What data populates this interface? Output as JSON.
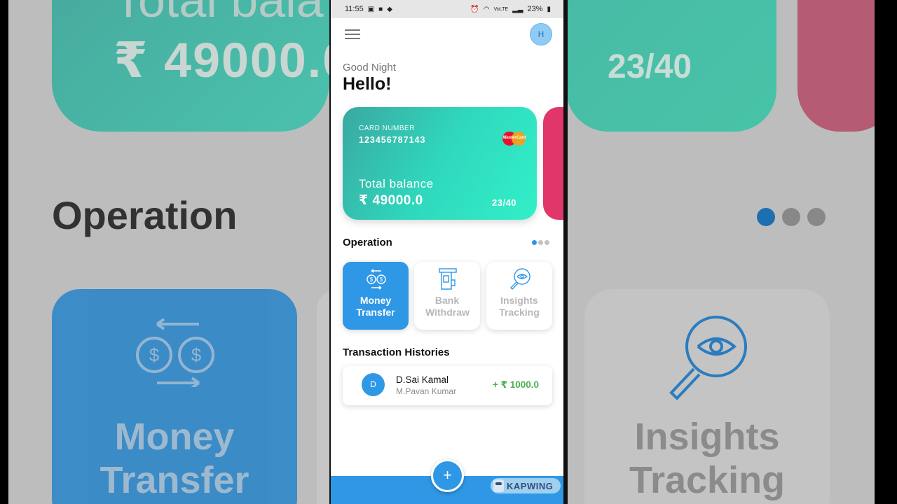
{
  "status_bar": {
    "time": "11:55",
    "network": "VoLTE",
    "battery": "23%"
  },
  "header": {
    "avatar_initial": "H"
  },
  "greeting": {
    "subtitle": "Good Night",
    "title": "Hello!"
  },
  "card": {
    "number_label": "CARD NUMBER",
    "number": "123456787143",
    "brand": "MasterCard",
    "balance_label": "Total balance",
    "balance": "₹ 49000.0",
    "ratio": "23/40"
  },
  "operation": {
    "title": "Operation",
    "page_count": 3,
    "active_page": 1,
    "tiles": [
      {
        "label": "Money Transfer",
        "icon": "money-transfer-icon",
        "active": true
      },
      {
        "label": "Bank Withdraw",
        "icon": "atm-icon",
        "active": false
      },
      {
        "label": "Insights Tracking",
        "icon": "insights-icon",
        "active": false
      }
    ]
  },
  "transactions": {
    "title": "Transaction Histories",
    "items": [
      {
        "initial": "D",
        "name": "D.Sai Kamal",
        "counterparty": "M.Pavan Kumar",
        "amount": "+ ₹ 1000.0"
      }
    ]
  },
  "fab": {
    "symbol": "+"
  },
  "watermark": {
    "text": "KAPWING"
  },
  "background": {
    "total_fragment": "Total bala",
    "balance_fragment": "₹ 49000.0",
    "ratio": "23/40",
    "operation": "Operation",
    "tile_left_line1": "Money",
    "tile_left_line2": "Transfer",
    "tile_right_line1": "Insights",
    "tile_right_line2": "Tracking"
  },
  "colors": {
    "accent": "#2f98e6",
    "card_start": "#3aa8a1",
    "card_end": "#32f0c8",
    "card2": "#e0366a",
    "positive": "#4caf50"
  }
}
